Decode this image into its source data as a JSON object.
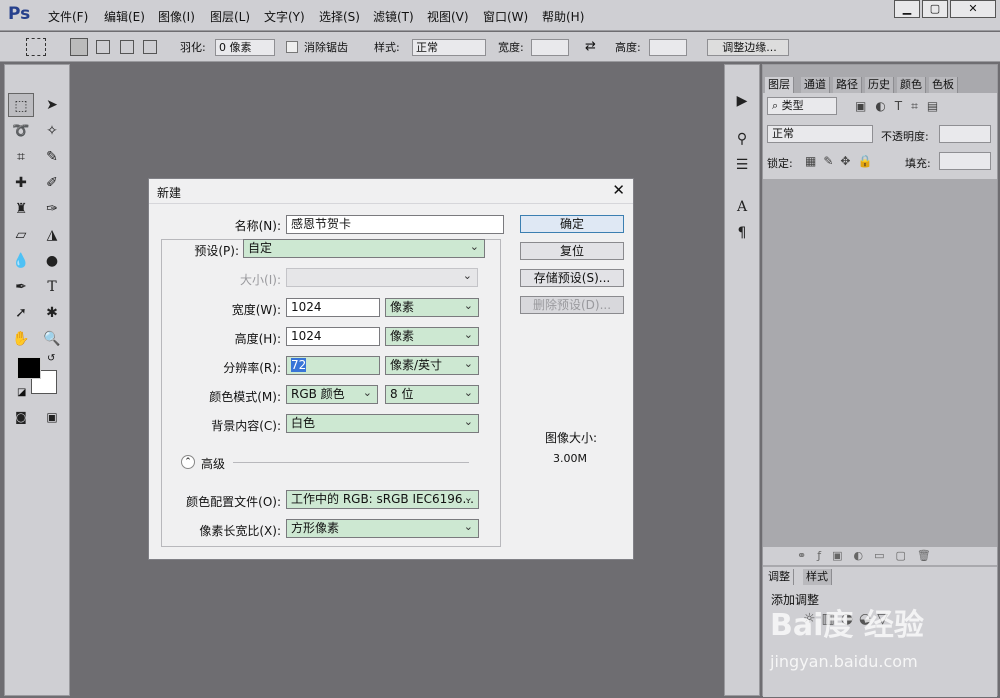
{
  "app": {
    "logo": "Ps",
    "menus": [
      "文件(F)",
      "编辑(E)",
      "图像(I)",
      "图层(L)",
      "文字(Y)",
      "选择(S)",
      "滤镜(T)",
      "视图(V)",
      "窗口(W)",
      "帮助(H)"
    ]
  },
  "options": {
    "feather_label": "羽化:",
    "feather_value": "0 像素",
    "antialias": "消除锯齿",
    "style_label": "样式:",
    "style_value": "正常",
    "width_label": "宽度:",
    "height_label": "高度:",
    "refine_edge": "调整边缘..."
  },
  "panel": {
    "tabs": [
      "图层",
      "通道",
      "路径",
      "历史",
      "颜色",
      "色板"
    ],
    "kind": "类型",
    "blend": "正常",
    "opacity_label": "不透明度:",
    "lock_label": "锁定:",
    "fill_label": "填充:",
    "adj_tabs": [
      "调整",
      "样式"
    ],
    "add_adjustment": "添加调整"
  },
  "dialog": {
    "title": "新建",
    "name_label": "名称(N):",
    "name_value": "感恩节贺卡",
    "preset_label": "预设(P):",
    "preset_value": "自定",
    "size_label": "大小(I):",
    "width_label": "宽度(W):",
    "width_value": "1024",
    "width_unit": "像素",
    "height_label": "高度(H):",
    "height_value": "1024",
    "height_unit": "像素",
    "res_label": "分辨率(R):",
    "res_value": "72",
    "res_unit": "像素/英寸",
    "mode_label": "颜色模式(M):",
    "mode_value": "RGB 颜色",
    "depth_value": "8 位",
    "bg_label": "背景内容(C):",
    "bg_value": "白色",
    "advanced": "高级",
    "profile_label": "颜色配置文件(O):",
    "profile_value": "工作中的 RGB: sRGB IEC6196...",
    "aspect_label": "像素长宽比(X):",
    "aspect_value": "方形像素",
    "ok": "确定",
    "reset": "复位",
    "save_preset": "存储预设(S)...",
    "delete_preset": "删除预设(D)...",
    "image_size_label": "图像大小:",
    "image_size_value": "3.00M"
  },
  "watermark": {
    "brand": "Bai度 经验",
    "url": "jingyan.baidu.com"
  }
}
